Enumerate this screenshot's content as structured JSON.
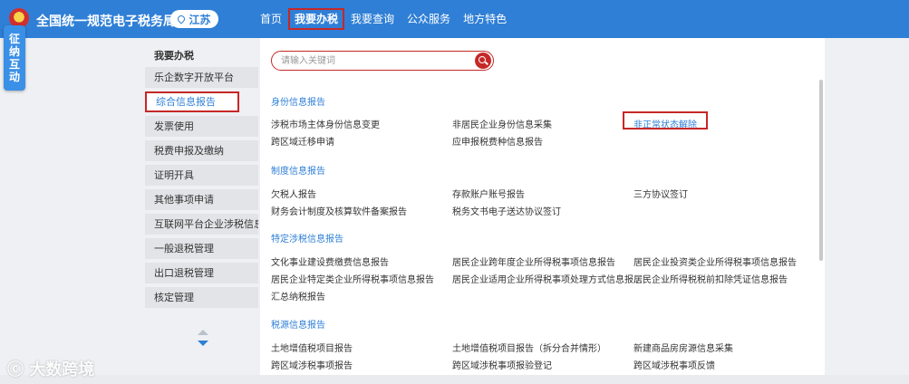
{
  "header": {
    "site_title": "全国统一规范电子税务局",
    "region": "江苏",
    "nav": [
      "首页",
      "我要办税",
      "我要查询",
      "公众服务",
      "地方特色"
    ]
  },
  "float_tab": {
    "chars": [
      "征",
      "纳",
      "互",
      "动"
    ]
  },
  "sidebar": {
    "heading": "我要办税",
    "items": [
      "乐企数字开放平台",
      "综合信息报告",
      "发票使用",
      "税费申报及缴纳",
      "证明开具",
      "其他事项申请",
      "互联网平台企业涉税信息报送",
      "一般退税管理",
      "出口退税管理",
      "核定管理"
    ]
  },
  "search": {
    "placeholder": "请输入关键词"
  },
  "sections": [
    {
      "title": "身份信息报告",
      "rows": [
        [
          "涉税市场主体身份信息变更",
          "非居民企业身份信息采集",
          "非正常状态解除"
        ],
        [
          "跨区域迁移申请",
          "应申报税费种信息报告",
          ""
        ]
      ]
    },
    {
      "title": "制度信息报告",
      "rows": [
        [
          "欠税人报告",
          "存款账户账号报告",
          "三方协议签订"
        ],
        [
          "财务会计制度及核算软件备案报告",
          "税务文书电子送达协议签订",
          ""
        ]
      ]
    },
    {
      "title": "特定涉税信息报告",
      "rows": [
        [
          "文化事业建设费缴费信息报告",
          "居民企业跨年度企业所得税事项信息报告",
          "居民企业投资类企业所得税事项信息报告"
        ],
        [
          "居民企业特定类企业所得税事项信息报告",
          "居民企业适用企业所得税事项处理方式信息报...",
          "居民企业所得税税前扣除凭证信息报告"
        ],
        [
          "汇总纳税报告",
          "",
          ""
        ]
      ]
    },
    {
      "title": "税源信息报告",
      "rows": [
        [
          "土地增值税项目报告",
          "土地增值税项目报告（拆分合并情形）",
          "新建商品房房源信息采集"
        ],
        [
          "跨区域涉税事项报告",
          "跨区域涉税事项报验登记",
          "跨区域涉税事项反馈"
        ]
      ]
    }
  ],
  "watermark": "大数跨境",
  "colors": {
    "header_blue": "#2f7fd6",
    "highlight_red": "#c62828",
    "link_blue": "#2f7fd6"
  }
}
